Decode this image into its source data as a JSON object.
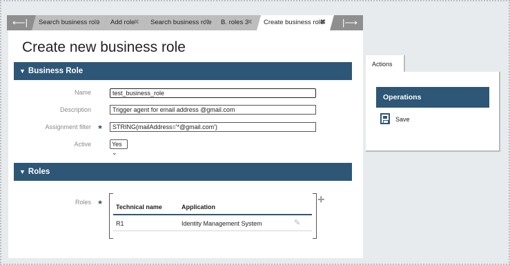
{
  "tabs": {
    "nav_left_icon": "arrow-left-icon",
    "nav_right_icon": "arrow-right-icon",
    "items": [
      {
        "label": "Search business role",
        "close": "✖"
      },
      {
        "label": "Add role",
        "close": "✖"
      },
      {
        "label": "Search business role",
        "close": "✖"
      },
      {
        "label": "B. roles 3",
        "close": "✖"
      },
      {
        "label": "Create business role",
        "close": "✖",
        "active": true
      }
    ]
  },
  "page": {
    "title": "Create new business role"
  },
  "business_role": {
    "section_title": "Business Role",
    "name_label": "Name",
    "name_value": "test_business_role",
    "description_label": "Description",
    "description_value": "Trigger agent for email address @gmail.com",
    "assignment_filter_label": "Assignment filter",
    "assignment_filter_value": "STRING(mailAddress='*@gmail.com')",
    "active_label": "Active",
    "active_value": "Yes"
  },
  "roles": {
    "section_title": "Roles",
    "label": "Roles",
    "columns": [
      "Technical name",
      "Application"
    ],
    "rows": [
      {
        "technical_name": "R1",
        "application": "Identity Management System"
      }
    ]
  },
  "actions": {
    "tab_label": "Actions",
    "operations_title": "Operations",
    "save_label": "Save"
  },
  "colors": {
    "section_header": "#2e5676",
    "tab_bar": "#8f8f8f",
    "background": "#e8ebee"
  }
}
